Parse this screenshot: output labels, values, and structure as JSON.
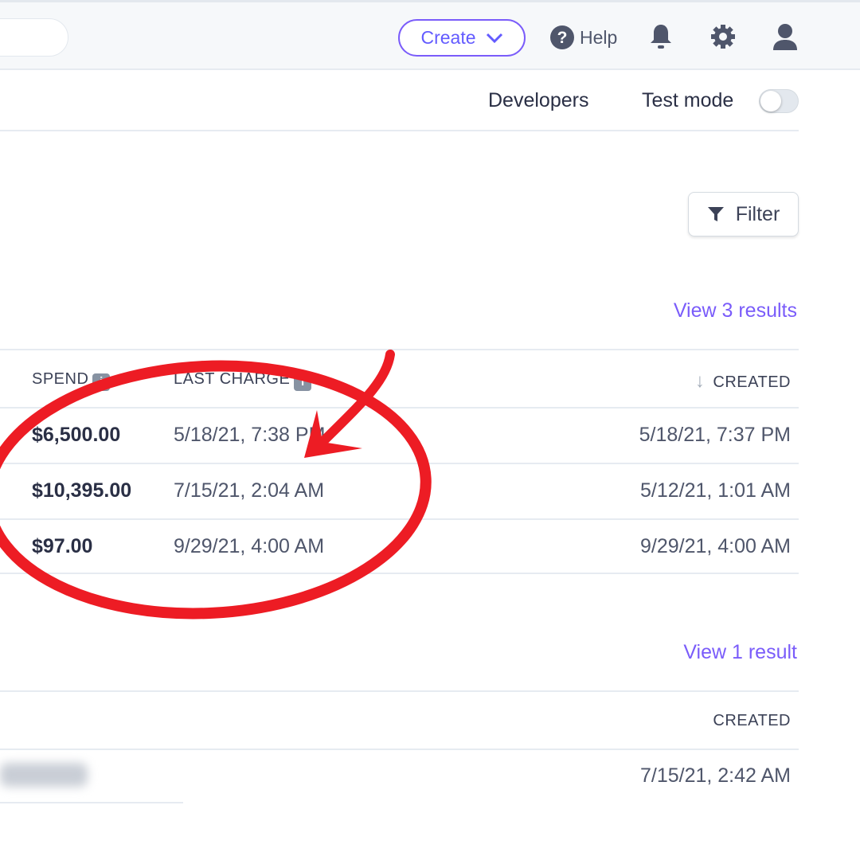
{
  "topbar": {
    "create_label": "Create",
    "help_label": "Help",
    "icons": [
      "chevron-down-icon",
      "help-circle-icon",
      "bell-icon",
      "gear-icon",
      "user-icon"
    ]
  },
  "subnav": {
    "developers": "Developers",
    "test_mode": "Test mode",
    "test_mode_on": false
  },
  "filter_label": "Filter",
  "section1": {
    "view_link": "View 3 results",
    "headers": {
      "spend": "SPEND",
      "last_charge": "LAST CHARGE",
      "created": "CREATED"
    },
    "rows": [
      {
        "spend": "$6,500.00",
        "last_charge": "5/18/21, 7:38 PM",
        "created": "5/18/21, 7:37 PM"
      },
      {
        "spend": "$10,395.00",
        "last_charge": "7/15/21, 2:04 AM",
        "created": "5/12/21, 1:01 AM"
      },
      {
        "spend": "$97.00",
        "last_charge": "9/29/21, 4:00 AM",
        "created": "9/29/21, 4:00 AM"
      }
    ]
  },
  "section2": {
    "view_link": "View 1 result",
    "headers": {
      "created": "CREATED"
    },
    "rows": [
      {
        "created": "7/15/21, 2:42 AM"
      }
    ]
  },
  "colors": {
    "accent": "#635bff",
    "annotation": "#ed1c24"
  }
}
